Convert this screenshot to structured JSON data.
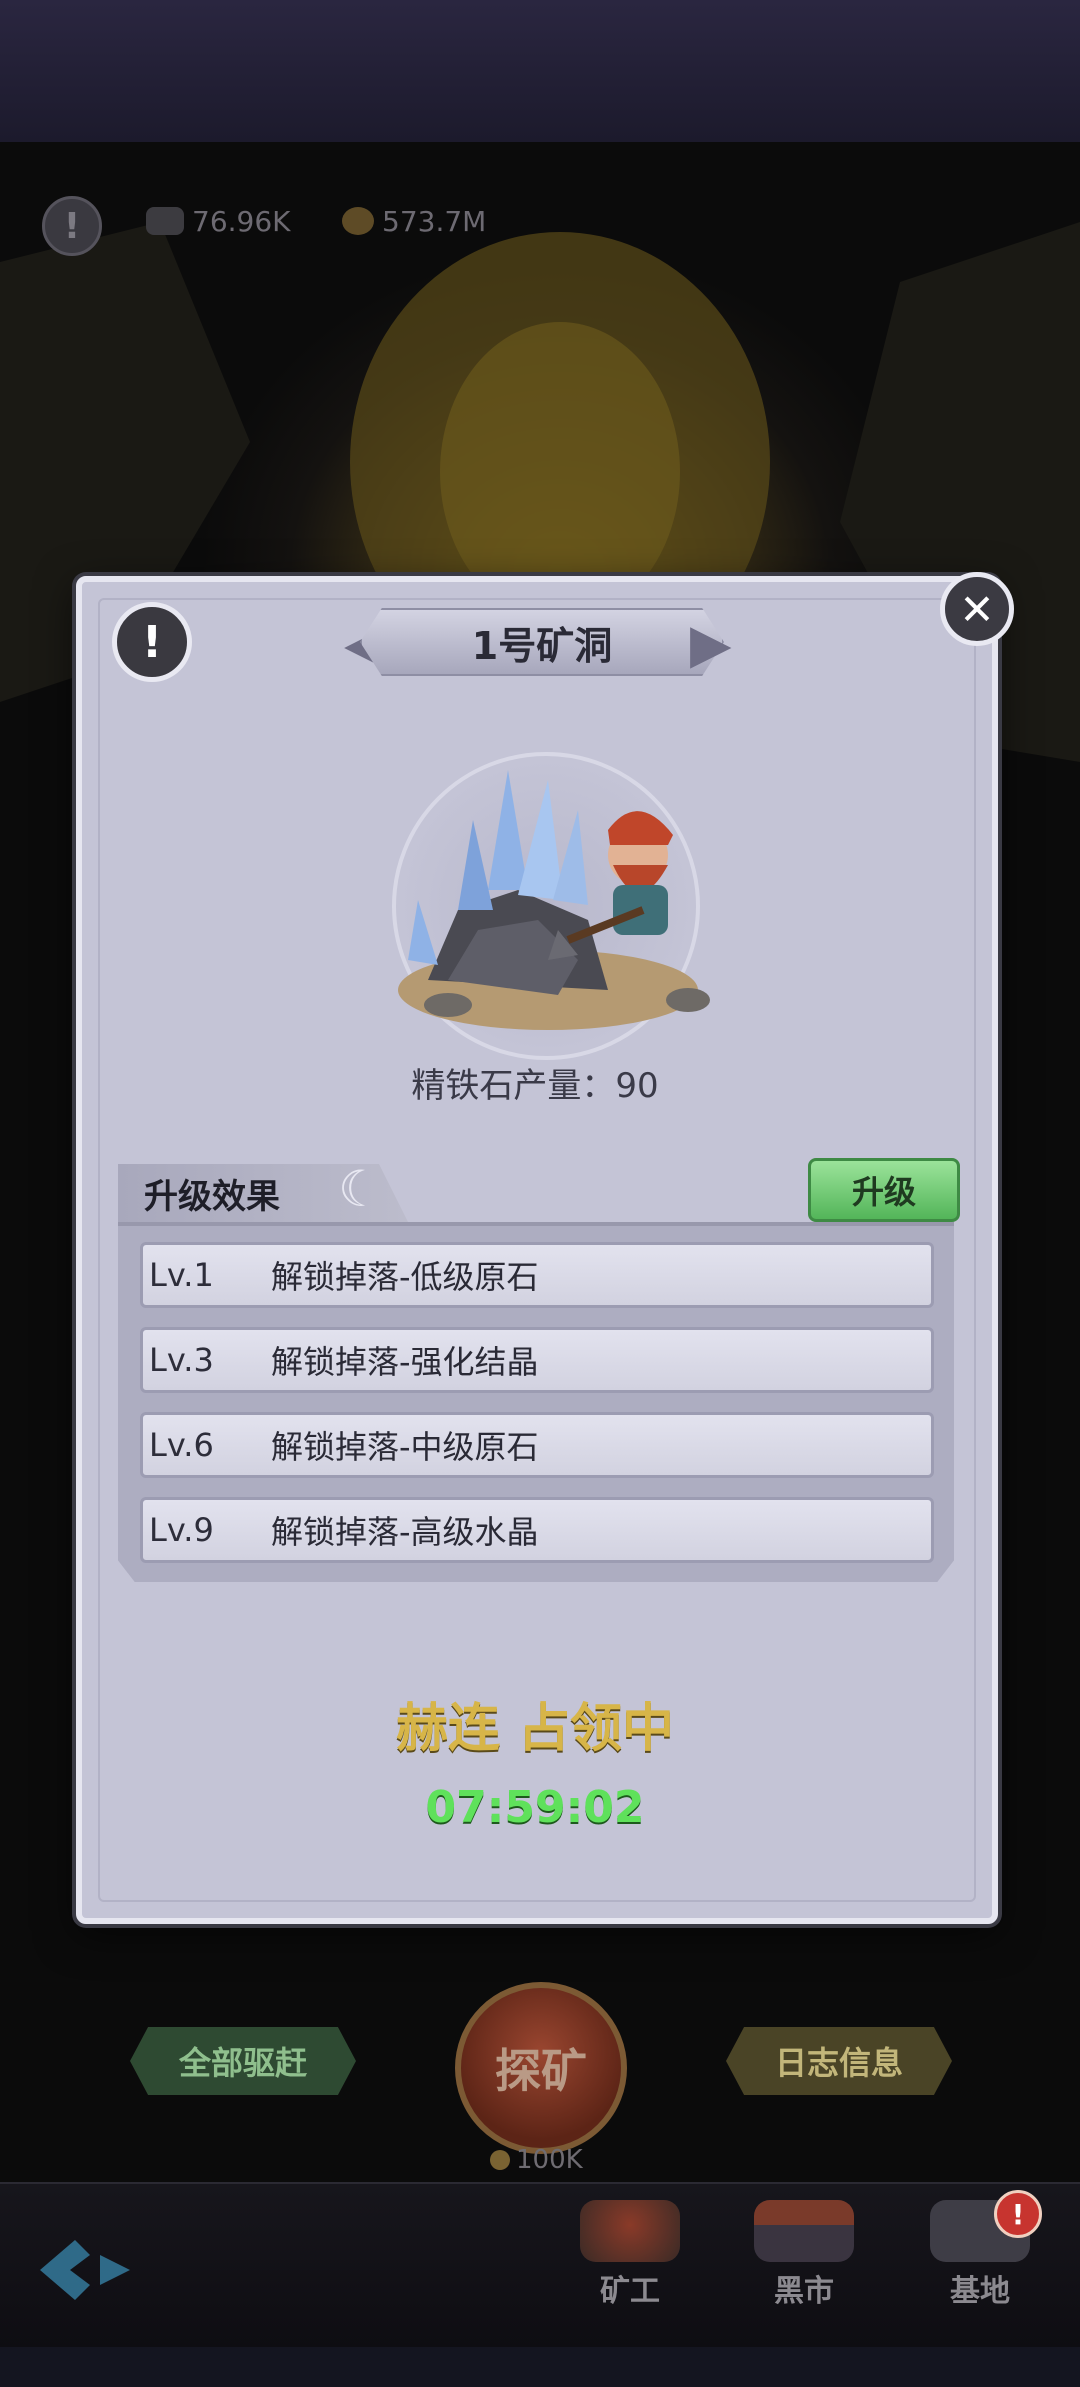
{
  "resources": {
    "ore": "76.96K",
    "coins": "573.7M"
  },
  "modal": {
    "title": "1号矿洞",
    "production_label": "精铁石产量：90",
    "upgrade_section_title": "升级效果",
    "upgrade_button": "升级",
    "effects": [
      {
        "level": "Lv.1",
        "text": "解锁掉落-低级原石"
      },
      {
        "level": "Lv.3",
        "text": "解锁掉落-强化结晶"
      },
      {
        "level": "Lv.6",
        "text": "解锁掉落-中级原石"
      },
      {
        "level": "Lv.9",
        "text": "解锁掉落-高级水晶"
      }
    ],
    "occupant": "赫连 占领中",
    "timer": "07:59:02"
  },
  "actions": {
    "evict_all": "全部驱赶",
    "explore": "探矿",
    "explore_cost": "100K",
    "log_info": "日志信息"
  },
  "nav": {
    "miners": "矿工",
    "black_market": "黑市",
    "base": "基地",
    "base_badge": "!"
  },
  "colors": {
    "modal_bg": "#c4c4d6",
    "accent_gold": "#d7b548",
    "timer_green": "#5fe15b",
    "upgrade_green": "#53b559"
  }
}
